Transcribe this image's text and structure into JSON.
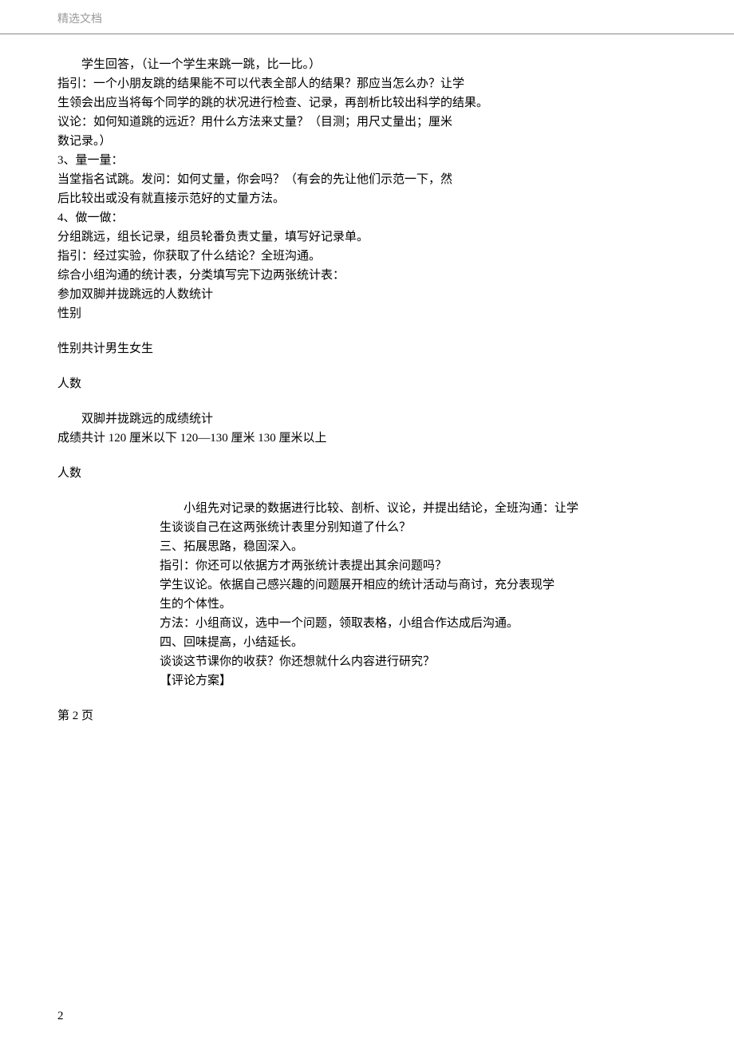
{
  "header": {
    "title": "精选文档"
  },
  "content": {
    "p1": "学生回答，（让一个学生来跳一跳，比一比。）",
    "p2": "指引：一个小朋友跳的结果能不可以代表全部人的结果？那应当怎么办？让学",
    "p3": "生领会出应当将每个同学的跳的状况进行检查、记录，再剖析比较出科学的结果。",
    "p4": "议论：如何知道跳的远近？用什么方法来丈量？（目测；用尺丈量出；厘米",
    "p5": "数记录。）",
    "p6": "3、量一量：",
    "p7": "当堂指名试跳。发问：如何丈量，你会吗？（有会的先让他们示范一下，然",
    "p8": "后比较出或没有就直接示范好的丈量方法。",
    "p9": "4、做一做：",
    "p10": "分组跳远，组长记录，组员轮番负责丈量，填写好记录单。",
    "p11": "指引：经过实验，你获取了什么结论？全班沟通。",
    "p12": "综合小组沟通的统计表，分类填写完下边两张统计表：",
    "p13": "参加双脚并拢跳远的人数统计",
    "p14": "性别",
    "p15": "性别共计男生女生",
    "p16": "人数",
    "p17": "双脚并拢跳远的成绩统计",
    "p18": "成绩共计 120 厘米以下 120—130 厘米 130 厘米以上",
    "p19": "人数",
    "p20": "小组先对记录的数据进行比较、剖析、议论，并提出结论，全班沟通：让学",
    "p21": "生谈谈自己在这两张统计表里分别知道了什么？",
    "p22": "三、拓展思路，稳固深入。",
    "p23": "指引：你还可以依据方才两张统计表提出其余问题吗？",
    "p24": "学生议论。依据自己感兴趣的问题展开相应的统计活动与商讨，充分表现学",
    "p25": "生的个体性。",
    "p26": "方法：小组商议，选中一个问题，领取表格，小组合作达成后沟通。",
    "p27": "四、回味提高，小结延长。",
    "p28": "谈谈这节课你的收获？你还想就什么内容进行研究？",
    "p29": "【评论方案】",
    "p30": "第 2 页"
  },
  "footer": {
    "pageNumber": "2"
  }
}
